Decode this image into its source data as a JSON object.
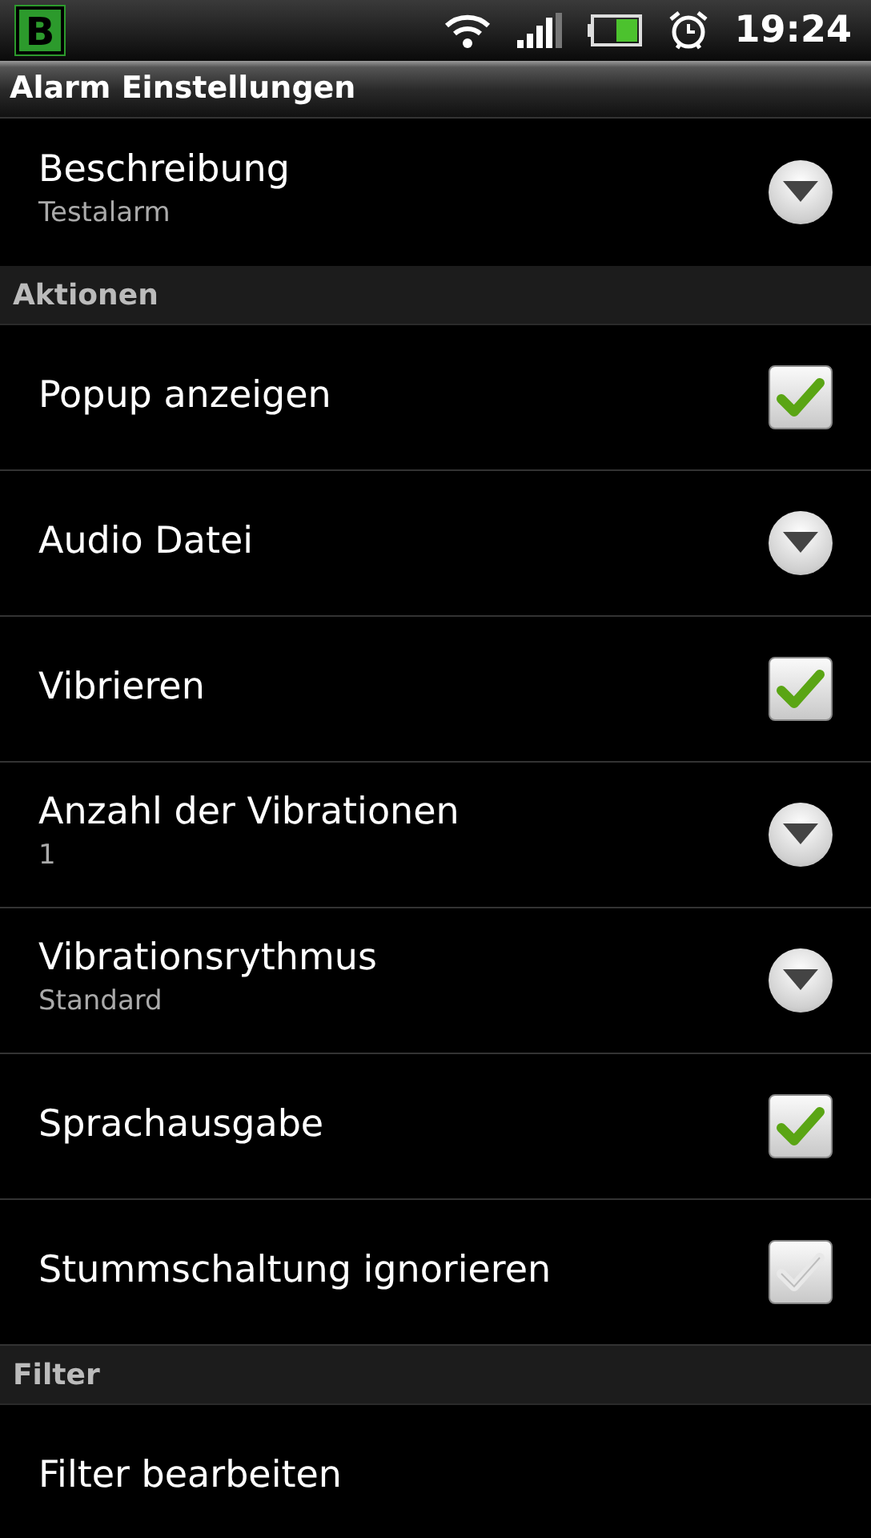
{
  "status_bar": {
    "time": "19:24",
    "app_letter": "B"
  },
  "title": "Alarm Einstellungen",
  "sections": [
    {
      "items": [
        {
          "kind": "dropdown",
          "title": "Beschreibung",
          "summary": "Testalarm"
        }
      ]
    },
    {
      "header": "Aktionen",
      "items": [
        {
          "kind": "checkbox",
          "title": "Popup anzeigen",
          "checked": true
        },
        {
          "kind": "dropdown",
          "title": "Audio Datei"
        },
        {
          "kind": "checkbox",
          "title": "Vibrieren",
          "checked": true
        },
        {
          "kind": "dropdown",
          "title": "Anzahl der Vibrationen",
          "summary": "1"
        },
        {
          "kind": "dropdown",
          "title": "Vibrationsrythmus",
          "summary": "Standard"
        },
        {
          "kind": "checkbox",
          "title": "Sprachausgabe",
          "checked": true
        },
        {
          "kind": "checkbox",
          "title": "Stummschaltung ignorieren",
          "checked": false
        }
      ]
    },
    {
      "header": "Filter",
      "items": [
        {
          "kind": "plain",
          "title": "Filter bearbeiten"
        }
      ]
    }
  ]
}
